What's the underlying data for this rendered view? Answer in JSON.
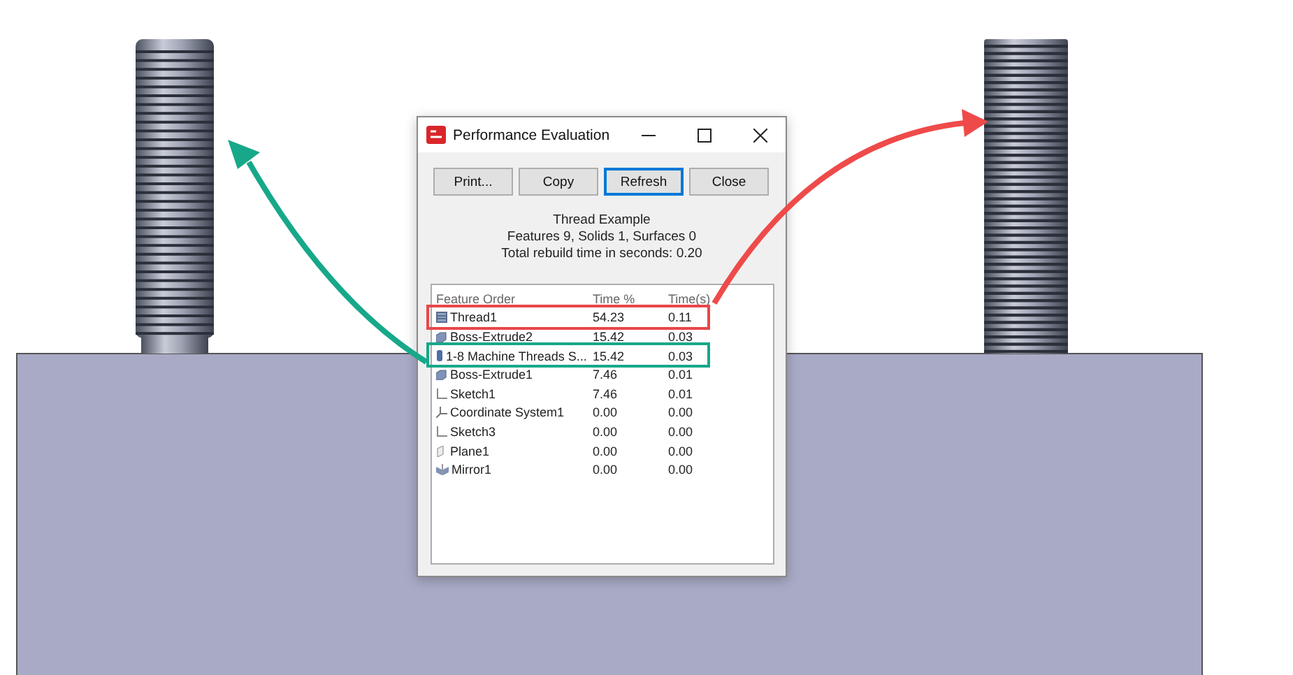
{
  "window": {
    "title": "Performance Evaluation"
  },
  "buttons": [
    {
      "label": "Print...",
      "focused": false
    },
    {
      "label": "Copy",
      "focused": false
    },
    {
      "label": "Refresh",
      "focused": true
    },
    {
      "label": "Close",
      "focused": false
    }
  ],
  "summary": [
    "Thread Example",
    "Features 9, Solids 1, Surfaces 0",
    "Total rebuild time in seconds: 0.20"
  ],
  "table": {
    "columns": [
      "Feature Order",
      "Time %",
      "Time(s)"
    ],
    "rows": [
      {
        "kind": "thread",
        "cells": [
          "Thread1",
          "54.23",
          "0.11"
        ],
        "color": "#e8474a"
      },
      {
        "kind": "extrude",
        "cells": [
          "Boss-Extrude2",
          "15.42",
          "0.03"
        ]
      },
      {
        "kind": "part",
        "cells": [
          "1-8 Machine Threads S...",
          "15.42",
          "0.03"
        ],
        "color": "#17a88a"
      },
      {
        "kind": "extrude",
        "cells": [
          "Boss-Extrude1",
          "7.46",
          "0.01"
        ]
      },
      {
        "kind": "sketch",
        "cells": [
          "Sketch1",
          "7.46",
          "0.01"
        ]
      },
      {
        "kind": "coordinate",
        "cells": [
          "Coordinate System1",
          "0.00",
          "0.00"
        ]
      },
      {
        "kind": "sketch",
        "cells": [
          "Sketch3",
          "0.00",
          "0.00"
        ]
      },
      {
        "kind": "plane",
        "cells": [
          "Plane1",
          "0.00",
          "0.00"
        ]
      },
      {
        "kind": "mirror",
        "cells": [
          "Mirror1",
          "0.00",
          "0.00"
        ]
      }
    ]
  }
}
